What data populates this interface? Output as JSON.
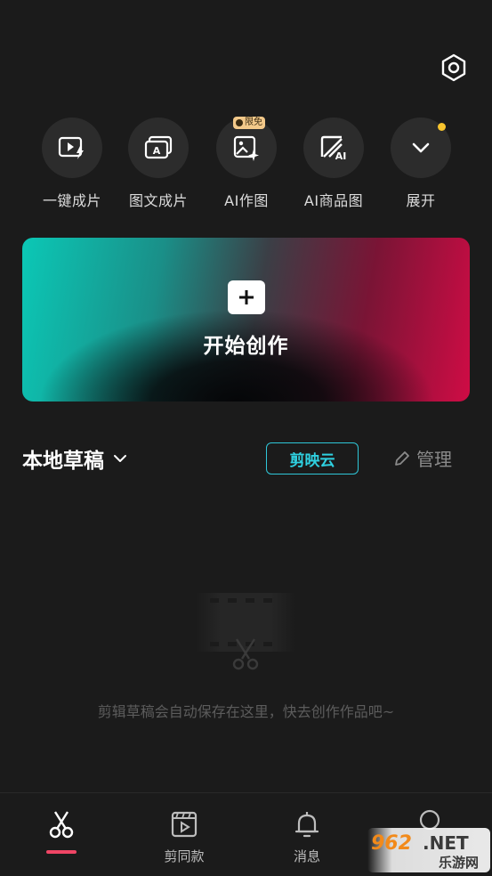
{
  "tools": [
    {
      "label": "一键成片",
      "icon": "one-click-video-icon"
    },
    {
      "label": "图文成片",
      "icon": "text-to-video-icon"
    },
    {
      "label": "AI作图",
      "icon": "ai-image-icon",
      "badge": "限免"
    },
    {
      "label": "AI商品图",
      "icon": "ai-product-image-icon"
    },
    {
      "label": "展开",
      "icon": "chevron-down-icon"
    }
  ],
  "create": {
    "label": "开始创作"
  },
  "drafts": {
    "title": "本地草稿",
    "cloud_label": "剪映云",
    "manage_label": "管理"
  },
  "empty": {
    "message": "剪辑草稿会自动保存在这里，快去创作作品吧~"
  },
  "tabbar": [
    {
      "label": "",
      "icon": "scissors-icon",
      "active": true
    },
    {
      "label": "剪同款",
      "icon": "template-icon"
    },
    {
      "label": "消息",
      "icon": "bell-icon"
    },
    {
      "label": "",
      "icon": "profile-icon"
    }
  ],
  "watermark": {
    "text": "962.NET",
    "sub": "乐游网"
  },
  "colors": {
    "accent": "#2fc7d8",
    "active_tab": "#f04565",
    "notify_dot": "#f7c42e"
  }
}
